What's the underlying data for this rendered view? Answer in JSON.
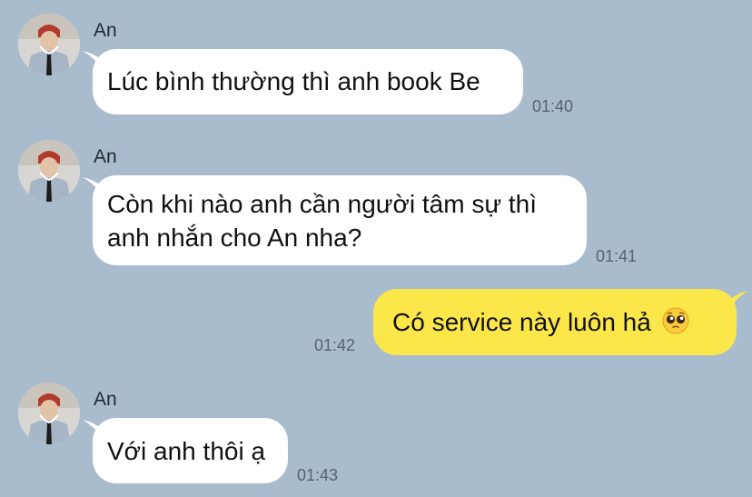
{
  "colors": {
    "background": "#a9bcce",
    "incoming_bubble": "#ffffff",
    "outgoing_bubble": "#fbe74a",
    "timestamp": "#55636f"
  },
  "messages": [
    {
      "direction": "incoming",
      "sender": "An",
      "text": "Lúc bình thường thì anh book Be",
      "time": "01:40"
    },
    {
      "direction": "incoming",
      "sender": "An",
      "line1": "Còn khi nào anh cần người tâm sự thì",
      "line2": "anh nhắn cho An nha?",
      "time": "01:41"
    },
    {
      "direction": "outgoing",
      "text": "Có service này luôn hả",
      "emoji": "pleading-face-emoji",
      "time": "01:42"
    },
    {
      "direction": "incoming",
      "sender": "An",
      "text": "Với anh thôi ạ",
      "time": "01:43"
    }
  ]
}
